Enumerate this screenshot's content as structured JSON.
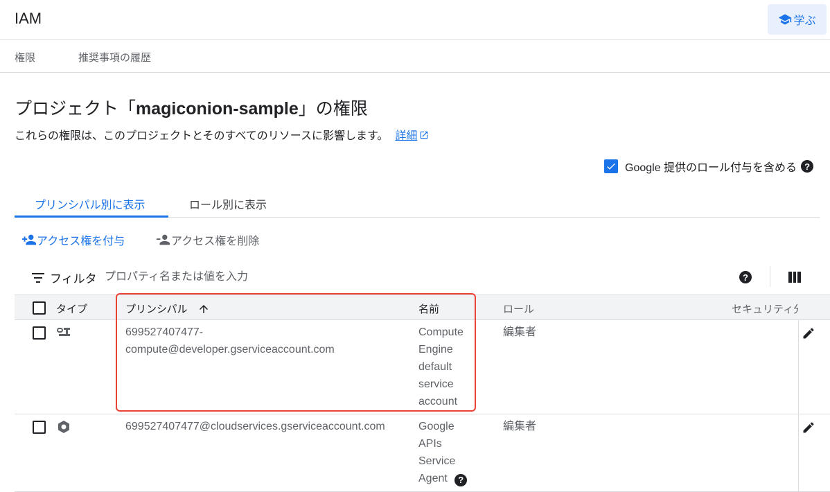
{
  "header": {
    "title": "IAM",
    "learn_label": "学ぶ"
  },
  "subtabs": [
    "権限",
    "推奨事項の履歴"
  ],
  "page": {
    "title_prefix": "プロジェクト「",
    "project_name": "magiconion-sample",
    "title_suffix": "」の権限",
    "description": "これらの権限は、このプロジェクトとそのすべてのリソースに影響します。",
    "details_link": "詳細"
  },
  "google_roles_checkbox": {
    "label": "Google 提供のロール付与を含める",
    "checked": true
  },
  "view_tabs": {
    "by_principal": "プリンシパル別に表示",
    "by_role": "ロール別に表示",
    "active": "by_principal"
  },
  "actions": {
    "grant": "アクセス権を付与",
    "remove": "アクセス権を削除"
  },
  "filter": {
    "label": "フィルタ",
    "placeholder": "プロパティ名または値を入力"
  },
  "table": {
    "columns": {
      "type": "タイプ",
      "principal": "プリンシパル",
      "name": "名前",
      "role": "ロール",
      "security": "セキュリティ分"
    },
    "sort": {
      "column": "principal",
      "direction": "ascending"
    },
    "rows": [
      {
        "type_icon": "service-account-icon",
        "principal": "699527407477-compute@developer.gserviceaccount.com",
        "name": "Compute Engine default service account",
        "role": "編集者"
      },
      {
        "type_icon": "google-cloud-hexagon-icon",
        "principal": "699527407477@cloudservices.gserviceaccount.com",
        "name": "Google APIs Service Agent",
        "role": "編集者"
      }
    ]
  },
  "colors": {
    "accent": "#1a73e8",
    "highlight": "#ea4335",
    "header_bg": "#f1f3f4"
  }
}
